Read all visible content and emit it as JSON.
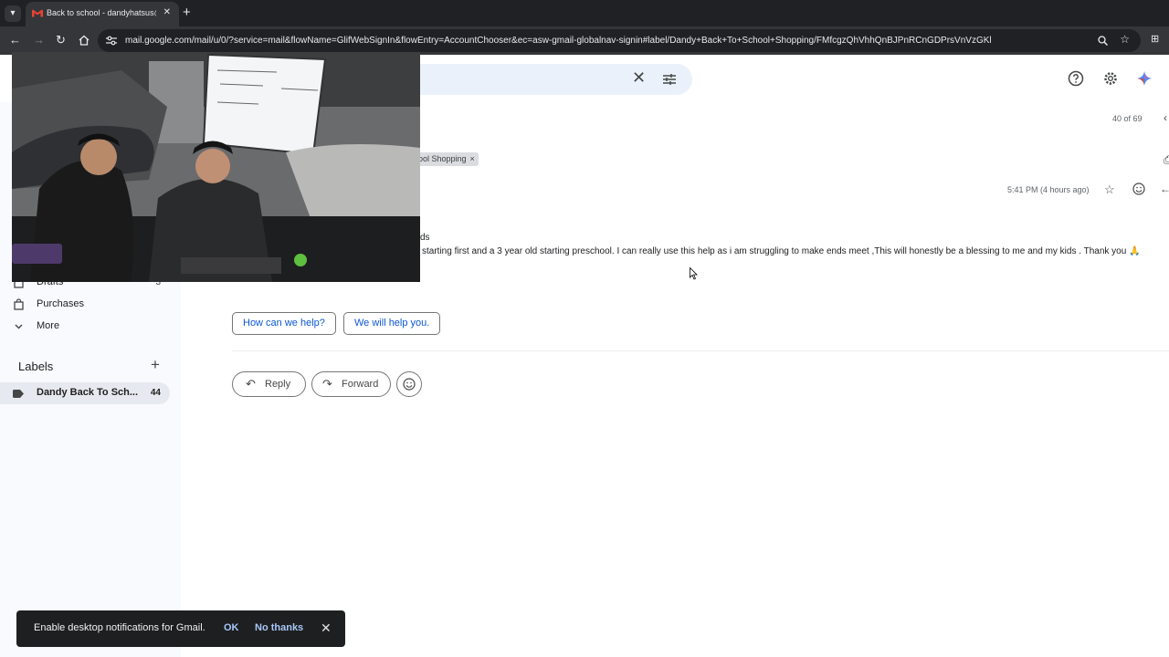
{
  "browser": {
    "tab_title": "Back to school - dandyhatsus@",
    "tab_close": "✕",
    "new_tab": "+",
    "url": "mail.google.com/mail/u/0/?service=mail&flowName=GlifWebSignIn&flowEntry=AccountChooser&ec=asw-gmail-globalnav-signin#label/Dandy+Back+To+School+Shopping/FMfcgzQhVhhQnBJPnRCnGDPrsVnVzGKl",
    "icons": [
      "tab-list-icon",
      "gmail-favicon",
      "back-icon",
      "forward-icon",
      "reload-icon",
      "home-icon",
      "site-settings-icon",
      "zoom-icon",
      "bookmark-star-icon",
      "extension-icon"
    ]
  },
  "header": {
    "clear_search": "✕",
    "icons": [
      "support-icon",
      "settings-icon",
      "gemini-icon"
    ]
  },
  "sidebar": {
    "items": [
      {
        "label": "Drafts",
        "count": "3"
      },
      {
        "label": "Purchases",
        "count": ""
      },
      {
        "label": "More",
        "count": ""
      }
    ],
    "labels_header": "Labels",
    "labels_add": "+",
    "labels": [
      {
        "label": "Dandy Back To Sch...",
        "count": "44",
        "color": "#444746"
      }
    ]
  },
  "message": {
    "pager": "40 of 69",
    "label_chip": "ool Shopping",
    "label_chip_remove": "×",
    "time": "5:41 PM (4 hours ago)",
    "body_line1": "ds",
    "body_line2": "starting first  and a 3 year old starting preschool. I can really use this help as i am struggling to make ends meet ,This will honestly be a blessing to me and my kids . Thank you 🙏",
    "smart_replies": [
      "How can we help?",
      "We will help you."
    ],
    "reply_label": "Reply",
    "forward_label": "Forward"
  },
  "snackbar": {
    "message": "Enable desktop notifications for Gmail.",
    "ok": "OK",
    "no_thanks": "No thanks",
    "close": "✕"
  },
  "colors": {
    "chrome_dark": "#202124",
    "chrome_toolbar": "#35363a",
    "sidebar_bg": "#f8fafd",
    "search_bg": "#eaf1fb",
    "link_blue": "#0b57d0",
    "snackbar_bg": "#1e1f20"
  }
}
